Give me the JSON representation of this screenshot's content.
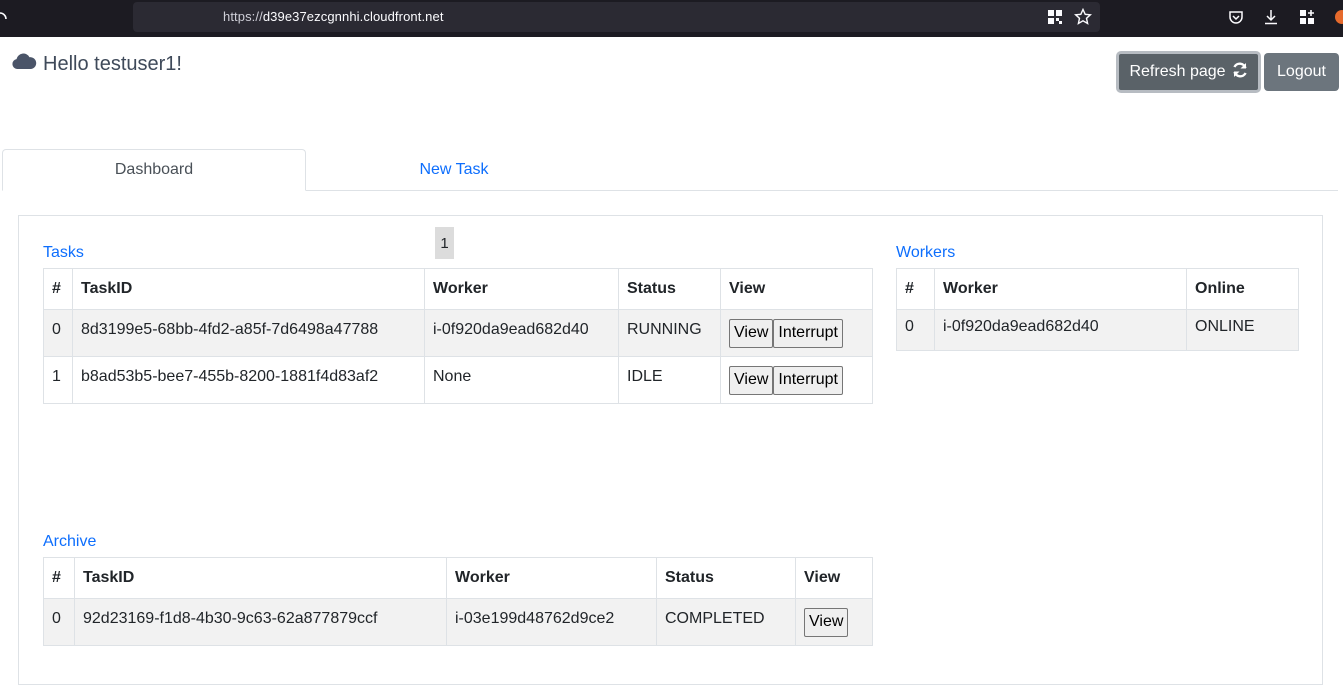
{
  "browser": {
    "url_prefix": "https://",
    "url_host": "d39e37ezcgnnhi.cloudfront.net"
  },
  "header": {
    "greeting": "Hello testuser1!",
    "refresh_label": "Refresh page",
    "logout_label": "Logout",
    "icons": {
      "greeting": "cloud-icon",
      "refresh": "refresh-icon"
    }
  },
  "tabs": [
    {
      "label": "Dashboard",
      "active": true
    },
    {
      "label": "New Task",
      "active": false
    }
  ],
  "tasks": {
    "title": "Tasks",
    "page_number": "1",
    "columns": [
      "#",
      "TaskID",
      "Worker",
      "Status",
      "View"
    ],
    "rows": [
      {
        "index": "0",
        "task_id": "8d3199e5-68bb-4fd2-a85f-7d6498a47788",
        "worker": "i-0f920da9ead682d40",
        "status": "RUNNING",
        "view_label": "View",
        "interrupt_label": "Interrupt"
      },
      {
        "index": "1",
        "task_id": "b8ad53b5-bee7-455b-8200-1881f4d83af2",
        "worker": "None",
        "status": "IDLE",
        "view_label": "View",
        "interrupt_label": "Interrupt"
      }
    ]
  },
  "workers": {
    "title": "Workers",
    "columns": [
      "#",
      "Worker",
      "Online"
    ],
    "rows": [
      {
        "index": "0",
        "worker": "i-0f920da9ead682d40",
        "online": "ONLINE"
      }
    ]
  },
  "archive": {
    "title": "Archive",
    "columns": [
      "#",
      "TaskID",
      "Worker",
      "Status",
      "View"
    ],
    "rows": [
      {
        "index": "0",
        "task_id": "92d23169-f1d8-4b30-9c63-62a877879ccf",
        "worker": "i-03e199d48762d9ce2",
        "status": "COMPLETED",
        "view_label": "View"
      }
    ]
  },
  "colors": {
    "link": "#0d6efd",
    "refresh_button": "#5a6268",
    "logout_button": "#6c757d",
    "striped_row": "#f2f2f2"
  }
}
